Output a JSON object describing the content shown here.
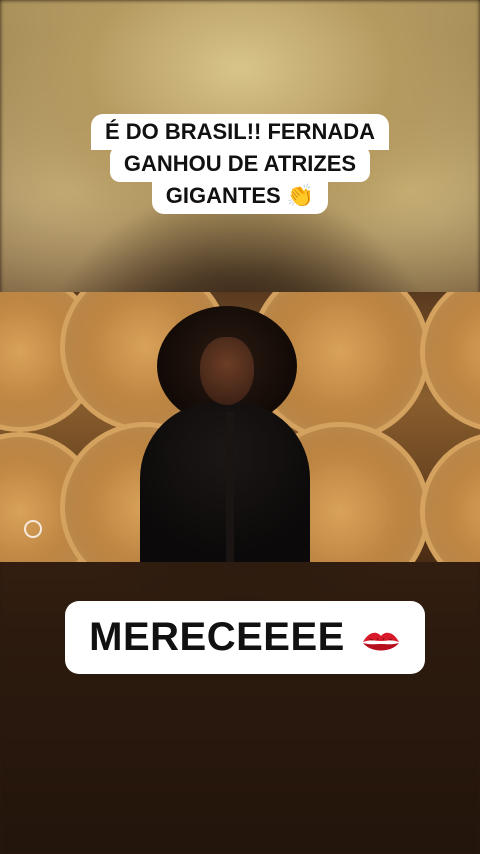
{
  "captions": {
    "top_lines": [
      "É DO BRASIL!! FERNADA",
      "GANHOU DE ATRIZES",
      "GIGANTES 👏"
    ],
    "bottom_text": "MERECEEEE",
    "bottom_emoji": "kiss-mark-icon"
  },
  "video": {
    "broadcaster_logo": "cbs-eye-icon"
  },
  "colors": {
    "caption_bg": "#ffffff",
    "caption_text": "#111111",
    "kiss_red": "#d8192a"
  }
}
